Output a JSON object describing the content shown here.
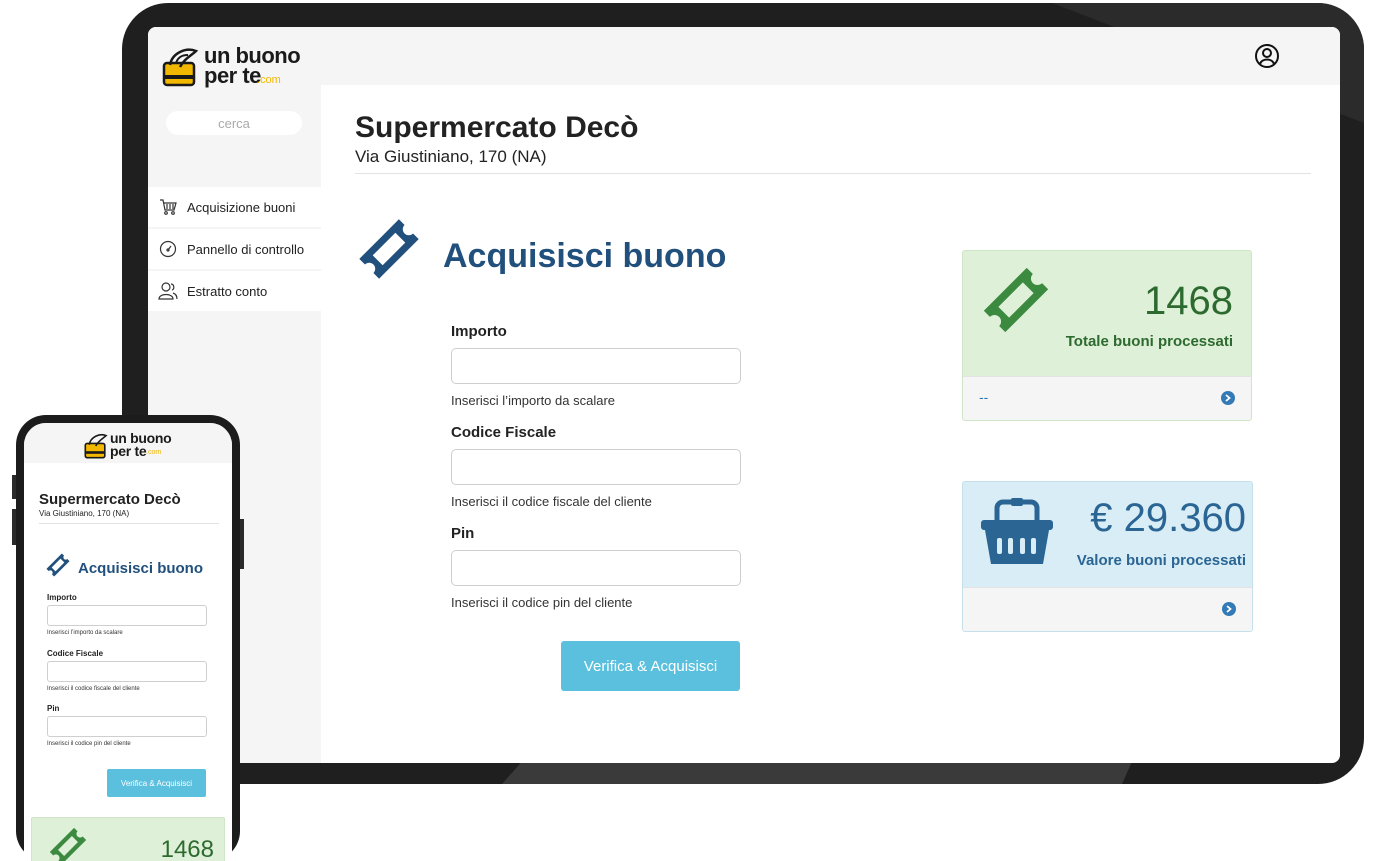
{
  "brand": {
    "logo_line1": "un buono",
    "logo_line2": "per te",
    "logo_suffix": ".com",
    "logo_color": "#f2b800"
  },
  "sidebar": {
    "search": {
      "placeholder": "cerca",
      "value": ""
    },
    "items": [
      {
        "label": "Acquisizione buoni",
        "icon": "shopping-cart-icon"
      },
      {
        "label": "Pannello di controllo",
        "icon": "dashboard-gauge-icon"
      },
      {
        "label": "Estratto conto",
        "icon": "users-icon"
      }
    ]
  },
  "header": {
    "user_icon": "user-circle-icon"
  },
  "store": {
    "name": "Supermercato Decò",
    "address": "Via Giustiniano, 170 (NA)"
  },
  "acquire": {
    "title": "Acquisisci buono",
    "icon": "ticket-icon",
    "accent_color": "#21507d",
    "fields": [
      {
        "label": "Importo",
        "value": "",
        "help": "Inserisci l’importo da scalare"
      },
      {
        "label": "Codice Fiscale",
        "value": "",
        "help": "Inserisci il codice fiscale del cliente"
      },
      {
        "label": "Pin",
        "value": "",
        "help": "Inserisci il codice pin del cliente"
      }
    ],
    "submit_label": "Verifica & Acquisisci",
    "submit_color": "#5bc0de"
  },
  "stats": {
    "processed": {
      "value": "1468",
      "label": "Totale buoni processati",
      "footer": "--",
      "icon": "ticket-icon",
      "color": "#dff0d8"
    },
    "amount": {
      "value": "€ 29.360",
      "label": "Valore buoni processati",
      "footer": "",
      "icon": "basket-icon",
      "color": "#d9edf7"
    }
  },
  "mobile": {
    "store_name": "Supermercato Decò",
    "store_address": "Via Giustiniano, 170 (NA)",
    "acquire_title": "Acquisisci buono",
    "fields": [
      {
        "label": "Importo",
        "value": "",
        "help": "Inserisci l’importo da scalare"
      },
      {
        "label": "Codice Fiscale",
        "value": "",
        "help": "Inserisci il codice fiscale del cliente"
      },
      {
        "label": "Pin",
        "value": "",
        "help": "Inserisci il codice pin del cliente"
      }
    ],
    "submit_label": "Verifica & Acquisisci",
    "processed_value": "1468"
  }
}
